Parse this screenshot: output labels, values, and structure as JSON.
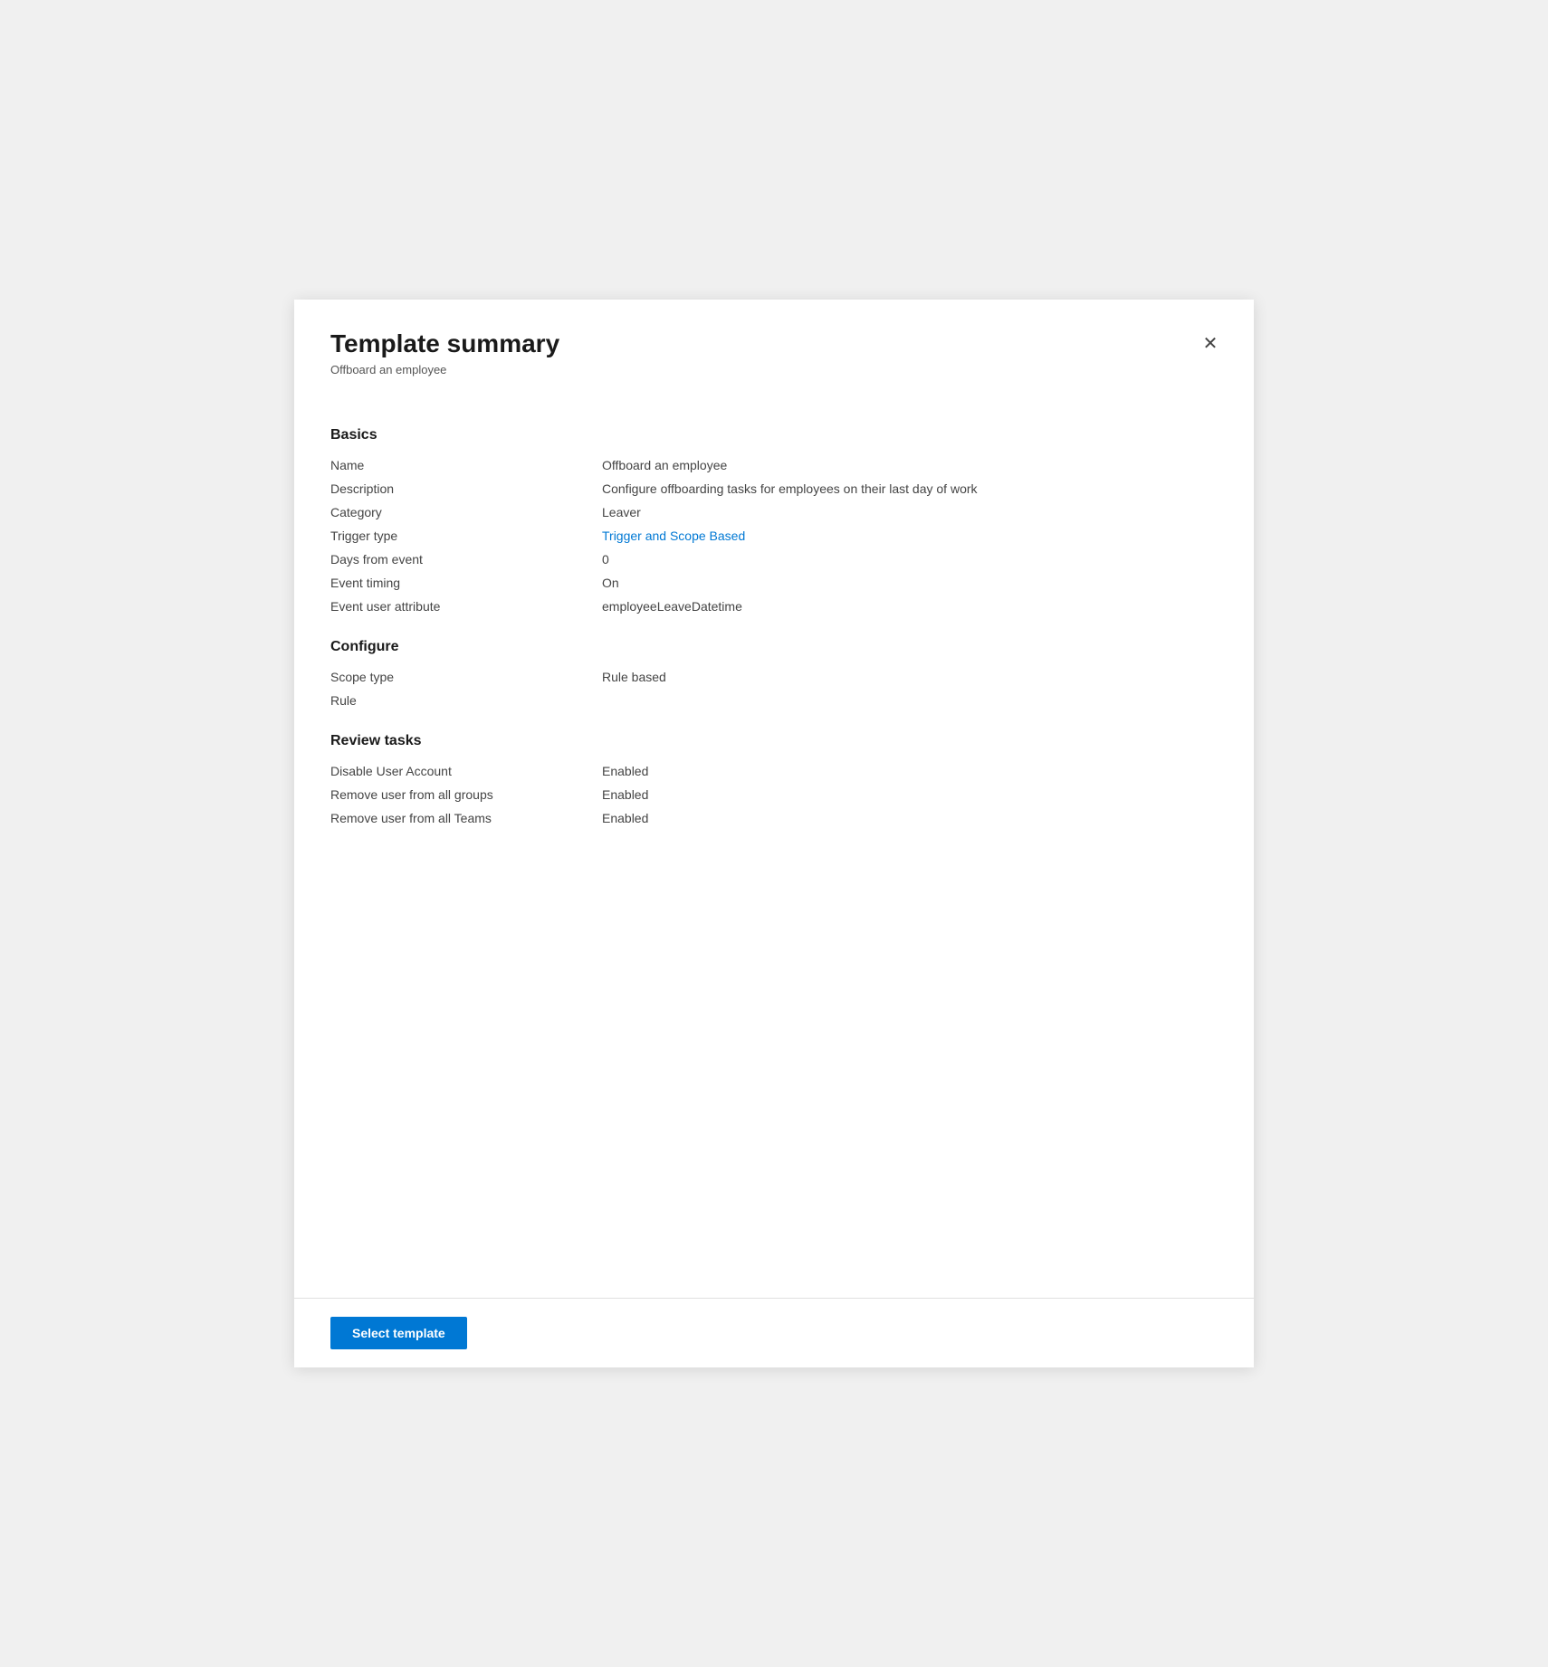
{
  "panel": {
    "title": "Template summary",
    "subtitle": "Offboard an employee",
    "close_icon": "✕"
  },
  "basics": {
    "heading": "Basics",
    "rows": [
      {
        "label": "Name",
        "value": "Offboard an employee",
        "style": "normal"
      },
      {
        "label": "Description",
        "value": "Configure offboarding tasks for employees on their last day of work",
        "style": "normal"
      },
      {
        "label": "Category",
        "value": "Leaver",
        "style": "normal"
      },
      {
        "label": "Trigger type",
        "value": "Trigger and Scope Based",
        "style": "link"
      },
      {
        "label": "Days from event",
        "value": "0",
        "style": "normal"
      },
      {
        "label": "Event timing",
        "value": "On",
        "style": "normal"
      },
      {
        "label": "Event user attribute",
        "value": "employeeLeaveDatetime",
        "style": "normal"
      }
    ]
  },
  "configure": {
    "heading": "Configure",
    "rows": [
      {
        "label": "Scope type",
        "value": "Rule based",
        "style": "normal"
      },
      {
        "label": "Rule",
        "value": "",
        "style": "normal"
      }
    ]
  },
  "review_tasks": {
    "heading": "Review tasks",
    "rows": [
      {
        "label": "Disable User Account",
        "value": "Enabled",
        "style": "normal"
      },
      {
        "label": "Remove user from all groups",
        "value": "Enabled",
        "style": "normal"
      },
      {
        "label": "Remove user from all Teams",
        "value": "Enabled",
        "style": "normal"
      }
    ]
  },
  "footer": {
    "select_template_label": "Select template"
  }
}
